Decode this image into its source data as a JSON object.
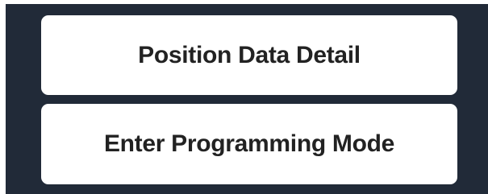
{
  "menu": {
    "buttons": [
      {
        "label": "Position Data Detail"
      },
      {
        "label": "Enter Programming Mode"
      }
    ]
  },
  "colors": {
    "panel_background": "#212a38",
    "button_background": "#ffffff",
    "button_text": "#222222"
  }
}
